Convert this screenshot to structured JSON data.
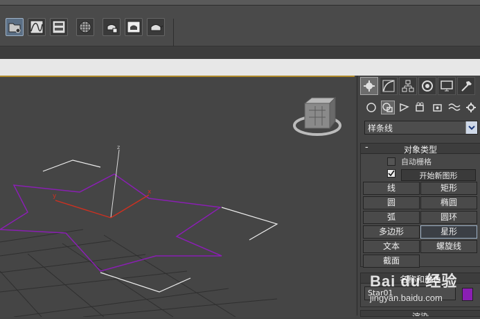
{
  "app": {
    "accent_color": "#b08a2a",
    "star_color": "#8a1fb3"
  },
  "toolbar": {
    "buttons": [
      {
        "name": "open-file-button",
        "icon": "folder-icon",
        "active": true
      },
      {
        "name": "curve-editor-button",
        "icon": "curve-icon"
      },
      {
        "name": "schematic-view-button",
        "icon": "schematic-icon"
      },
      {
        "name": "material-editor-button",
        "icon": "material-ball-icon"
      },
      {
        "name": "render-setup-button",
        "icon": "teapot-setup-icon"
      },
      {
        "name": "render-frame-button",
        "icon": "teapot-frame-icon"
      },
      {
        "name": "render-button",
        "icon": "teapot-icon"
      }
    ]
  },
  "viewport": {
    "axis_labels": {
      "z": "z",
      "y": "y",
      "x": "x"
    },
    "colors": {
      "star": "#8a1fb3",
      "grid": "#2f2f2f",
      "gizmo": "#ffffff",
      "x_axis": "#d03020"
    }
  },
  "command_panel": {
    "tabs": [
      {
        "name": "tab-create",
        "icon": "create-icon",
        "active": true
      },
      {
        "name": "tab-modify",
        "icon": "modify-icon"
      },
      {
        "name": "tab-hierarchy",
        "icon": "hierarchy-icon"
      },
      {
        "name": "tab-motion",
        "icon": "motion-icon"
      },
      {
        "name": "tab-display",
        "icon": "display-icon"
      },
      {
        "name": "tab-utilities",
        "icon": "hammer-icon"
      }
    ],
    "categories": [
      {
        "name": "geometry",
        "icon": "sphere-icon"
      },
      {
        "name": "shapes",
        "icon": "shapes-icon",
        "active": true
      },
      {
        "name": "lights",
        "icon": "light-icon"
      },
      {
        "name": "cameras",
        "icon": "camera-icon"
      },
      {
        "name": "helpers",
        "icon": "helper-icon"
      },
      {
        "name": "space-warps",
        "icon": "wave-icon"
      },
      {
        "name": "systems",
        "icon": "gear-icon"
      }
    ],
    "dropdown_value": "样条线",
    "object_type": {
      "title": "对象类型",
      "toggle": "-",
      "auto_grid": "自动栅格",
      "start_new_shape": "开始新图形",
      "buttons": [
        {
          "label": "线"
        },
        {
          "label": "矩形"
        },
        {
          "label": "圆"
        },
        {
          "label": "椭圆"
        },
        {
          "label": "弧"
        },
        {
          "label": "圆环"
        },
        {
          "label": "多边形"
        },
        {
          "label": "星形",
          "active": true
        },
        {
          "label": "文本"
        },
        {
          "label": "螺旋线"
        },
        {
          "label": "截面"
        }
      ]
    },
    "name_color": {
      "title": "名称和颜色",
      "name_value": "Star01",
      "color": "#8a1fb3"
    },
    "rendering": {
      "title": "渲染"
    }
  },
  "watermark": {
    "brand": "Bai du 经验",
    "url": "jingyan.baidu.com"
  }
}
